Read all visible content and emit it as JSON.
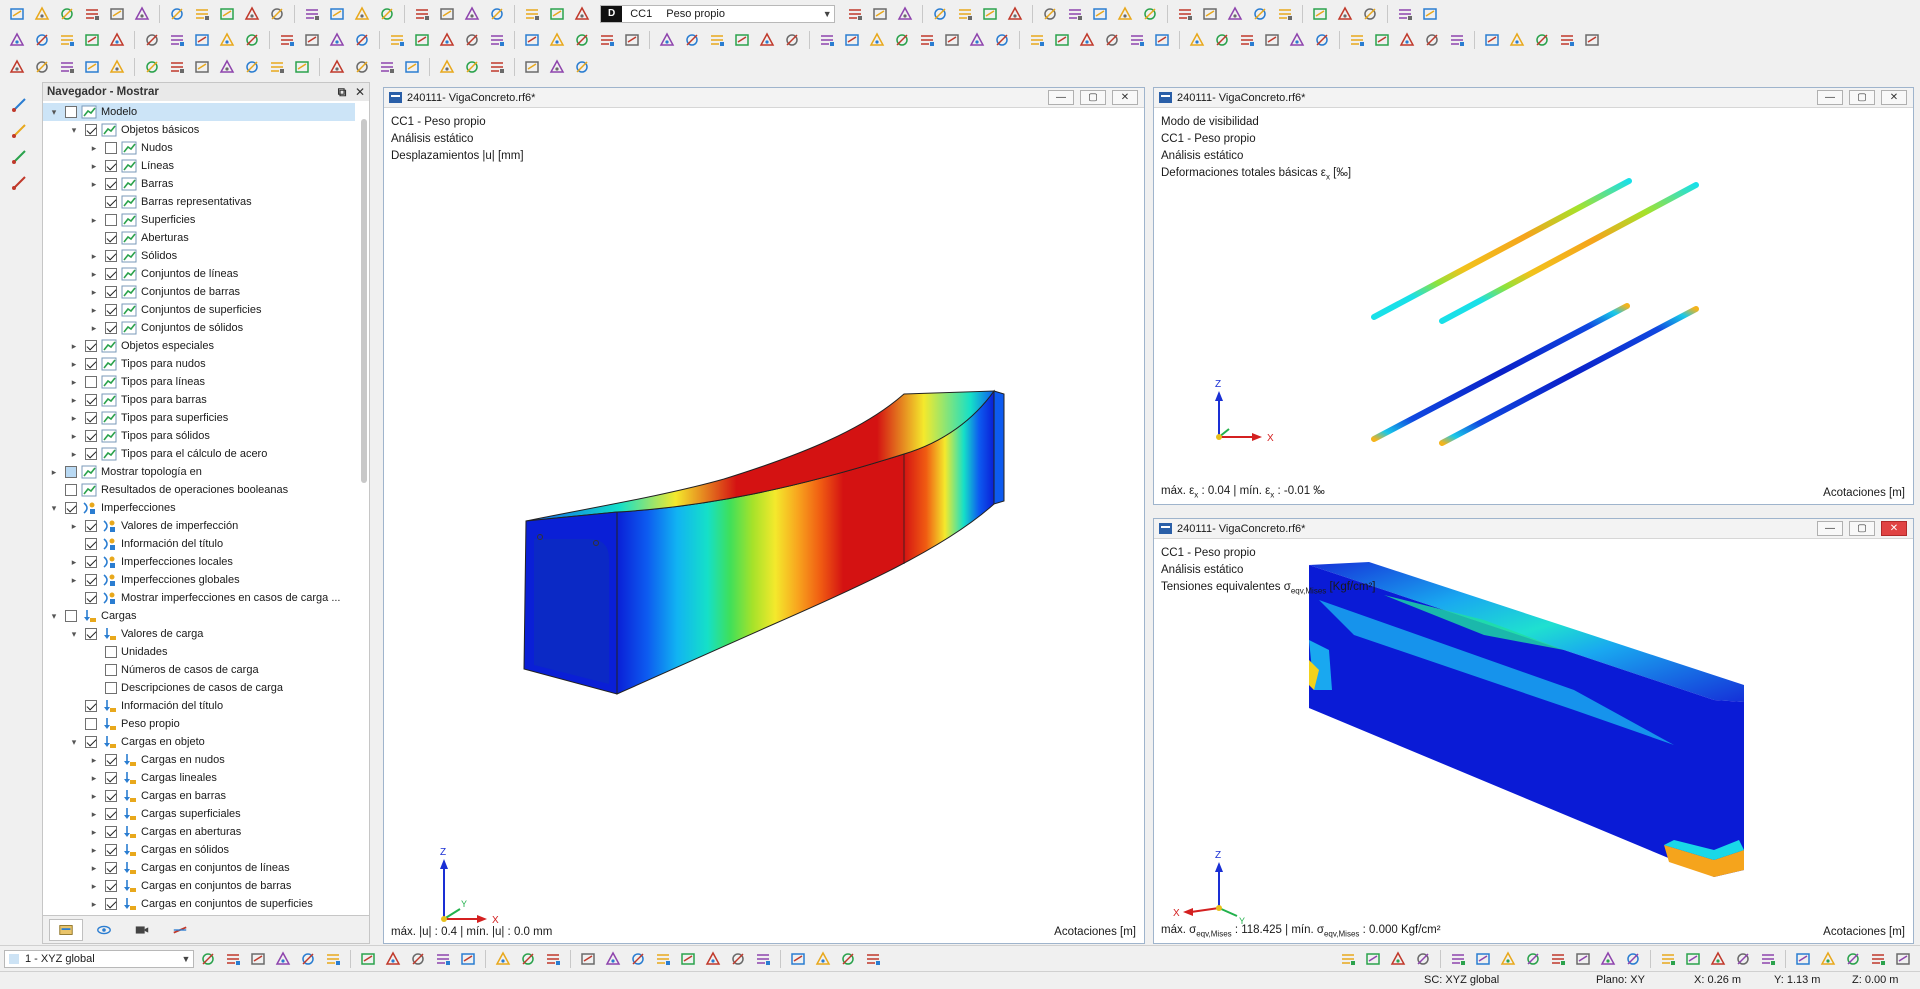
{
  "toolbar": {
    "loadcase_tag": "D",
    "loadcase_code": "CC1",
    "loadcase_name": "Peso propio"
  },
  "navigator": {
    "title": "Navegador - Mostrar",
    "items": [
      {
        "label": "Modelo",
        "level": 0,
        "exp": "open",
        "checked": "none",
        "icon": "model-icon",
        "selected": true
      },
      {
        "label": "Objetos básicos",
        "level": 1,
        "exp": "open",
        "checked": "yes",
        "icon": "graph-icon"
      },
      {
        "label": "Nudos",
        "level": 2,
        "exp": "closed",
        "checked": "none",
        "icon": "graph-icon"
      },
      {
        "label": "Líneas",
        "level": 2,
        "exp": "closed",
        "checked": "yes",
        "icon": "graph-icon"
      },
      {
        "label": "Barras",
        "level": 2,
        "exp": "closed",
        "checked": "yes",
        "icon": "graph-icon"
      },
      {
        "label": "Barras representativas",
        "level": 2,
        "exp": "",
        "checked": "yes",
        "icon": "graph-icon"
      },
      {
        "label": "Superficies",
        "level": 2,
        "exp": "closed",
        "checked": "none",
        "icon": "graph-icon"
      },
      {
        "label": "Aberturas",
        "level": 2,
        "exp": "",
        "checked": "yes",
        "icon": "graph-icon"
      },
      {
        "label": "Sólidos",
        "level": 2,
        "exp": "closed",
        "checked": "yes",
        "icon": "graph-icon"
      },
      {
        "label": "Conjuntos de líneas",
        "level": 2,
        "exp": "closed",
        "checked": "yes",
        "icon": "graph-icon"
      },
      {
        "label": "Conjuntos de barras",
        "level": 2,
        "exp": "closed",
        "checked": "yes",
        "icon": "graph-icon"
      },
      {
        "label": "Conjuntos de superficies",
        "level": 2,
        "exp": "closed",
        "checked": "yes",
        "icon": "graph-icon"
      },
      {
        "label": "Conjuntos de sólidos",
        "level": 2,
        "exp": "closed",
        "checked": "yes",
        "icon": "graph-icon"
      },
      {
        "label": "Objetos especiales",
        "level": 1,
        "exp": "closed",
        "checked": "yes",
        "icon": "graph-icon"
      },
      {
        "label": "Tipos para nudos",
        "level": 1,
        "exp": "closed",
        "checked": "yes",
        "icon": "graph-icon"
      },
      {
        "label": "Tipos para líneas",
        "level": 1,
        "exp": "closed",
        "checked": "none",
        "icon": "graph-icon"
      },
      {
        "label": "Tipos para barras",
        "level": 1,
        "exp": "closed",
        "checked": "yes",
        "icon": "graph-icon"
      },
      {
        "label": "Tipos para superficies",
        "level": 1,
        "exp": "closed",
        "checked": "yes",
        "icon": "graph-icon"
      },
      {
        "label": "Tipos para sólidos",
        "level": 1,
        "exp": "closed",
        "checked": "yes",
        "icon": "graph-icon"
      },
      {
        "label": "Tipos para el cálculo de acero",
        "level": 1,
        "exp": "closed",
        "checked": "yes",
        "icon": "graph-icon"
      },
      {
        "label": "Mostrar topología en",
        "level": 0,
        "exp": "closed",
        "checked": "partial",
        "icon": "graph-icon"
      },
      {
        "label": "Resultados de operaciones booleanas",
        "level": 0,
        "exp": "",
        "checked": "none",
        "icon": "graph-icon"
      },
      {
        "label": "Imperfecciones",
        "level": 0,
        "exp": "open",
        "checked": "yes",
        "icon": "imperfection-icon"
      },
      {
        "label": "Valores de imperfección",
        "level": 1,
        "exp": "closed",
        "checked": "yes",
        "icon": "imperfection-icon"
      },
      {
        "label": "Información del título",
        "level": 1,
        "exp": "",
        "checked": "yes",
        "icon": "imperfection-icon"
      },
      {
        "label": "Imperfecciones locales",
        "level": 1,
        "exp": "closed",
        "checked": "yes",
        "icon": "imperfection-icon"
      },
      {
        "label": "Imperfecciones globales",
        "level": 1,
        "exp": "closed",
        "checked": "yes",
        "icon": "imperfection-icon"
      },
      {
        "label": "Mostrar imperfecciones en casos de carga ...",
        "level": 1,
        "exp": "",
        "checked": "yes",
        "icon": "imperfection-icon"
      },
      {
        "label": "Cargas",
        "level": 0,
        "exp": "open",
        "checked": "none",
        "icon": "load-icon"
      },
      {
        "label": "Valores de carga",
        "level": 1,
        "exp": "open",
        "checked": "yes",
        "icon": "load-icon"
      },
      {
        "label": "Unidades",
        "level": 2,
        "exp": "",
        "checked": "none",
        "icon": ""
      },
      {
        "label": "Números de casos de carga",
        "level": 2,
        "exp": "",
        "checked": "none",
        "icon": ""
      },
      {
        "label": "Descripciones de casos de carga",
        "level": 2,
        "exp": "",
        "checked": "none",
        "icon": ""
      },
      {
        "label": "Información del título",
        "level": 1,
        "exp": "",
        "checked": "yes",
        "icon": "load-icon"
      },
      {
        "label": "Peso propio",
        "level": 1,
        "exp": "",
        "checked": "none",
        "icon": "load-icon"
      },
      {
        "label": "Cargas en objeto",
        "level": 1,
        "exp": "open",
        "checked": "yes",
        "icon": "load-icon"
      },
      {
        "label": "Cargas en nudos",
        "level": 2,
        "exp": "closed",
        "checked": "yes",
        "icon": "load-icon"
      },
      {
        "label": "Cargas lineales",
        "level": 2,
        "exp": "closed",
        "checked": "yes",
        "icon": "load-icon"
      },
      {
        "label": "Cargas en barras",
        "level": 2,
        "exp": "closed",
        "checked": "yes",
        "icon": "load-icon"
      },
      {
        "label": "Cargas superficiales",
        "level": 2,
        "exp": "closed",
        "checked": "yes",
        "icon": "load-icon"
      },
      {
        "label": "Cargas en aberturas",
        "level": 2,
        "exp": "closed",
        "checked": "yes",
        "icon": "load-icon"
      },
      {
        "label": "Cargas en sólidos",
        "level": 2,
        "exp": "closed",
        "checked": "yes",
        "icon": "load-icon"
      },
      {
        "label": "Cargas en conjuntos de líneas",
        "level": 2,
        "exp": "closed",
        "checked": "yes",
        "icon": "load-icon"
      },
      {
        "label": "Cargas en conjuntos de barras",
        "level": 2,
        "exp": "closed",
        "checked": "yes",
        "icon": "load-icon"
      },
      {
        "label": "Cargas en conjuntos de superficies",
        "level": 2,
        "exp": "closed",
        "checked": "yes",
        "icon": "load-icon"
      }
    ]
  },
  "windows": {
    "main": {
      "title": "240111- VigaConcreto.rf6*",
      "info": [
        "CC1 - Peso propio",
        "Análisis estático",
        "Desplazamientos |u| [mm]"
      ],
      "footer_left": "máx. |u| : 0.4 | mín. |u| : 0.0 mm",
      "footer_right": "Acotaciones [m]"
    },
    "top_right": {
      "title": "240111- VigaConcreto.rf6*",
      "info": [
        "Modo de visibilidad",
        "CC1 - Peso propio",
        "Análisis estático"
      ],
      "info_result_prefix": "Deformaciones totales básicas ε",
      "info_result_sub": "x",
      "info_result_suffix": " [‰]",
      "footer_max_prefix": "máx. ε",
      "footer_max_sub": "x",
      "footer_max_value": " : 0.04 | mín. ε",
      "footer_min_sub": "x",
      "footer_min_value": " : -0.01 ‰",
      "footer_right": "Acotaciones [m]"
    },
    "bottom_right": {
      "title": "240111- VigaConcreto.rf6*",
      "info": [
        "CC1 - Peso propio",
        "Análisis estático"
      ],
      "info_result_prefix": "Tensiones equivalentes σ",
      "info_result_sub": "eqv,Mises",
      "info_result_suffix": " [Kgf/cm²]",
      "footer_max_prefix": "máx. σ",
      "footer_max_sub": "eqv,Mises",
      "footer_max_value": " : 118.425 | mín. σ",
      "footer_min_sub": "eqv,Mises",
      "footer_min_value": " : 0.000 Kgf/cm²",
      "footer_right": "Acotaciones [m]"
    }
  },
  "axes": {
    "x": "X",
    "y": "Y",
    "z": "Z"
  },
  "bottom_toolbar": {
    "coord_system": "1 - XYZ global"
  },
  "status": {
    "sc": "SC: XYZ global",
    "plane": "Plano: XY",
    "x": "X: 0.26 m",
    "y": "Y: 1.13 m",
    "z": "Z: 0.00 m"
  },
  "colors": {
    "accent": "#2a7dd1",
    "selected_row": "#cce4f7",
    "close_red": "#e04343"
  }
}
